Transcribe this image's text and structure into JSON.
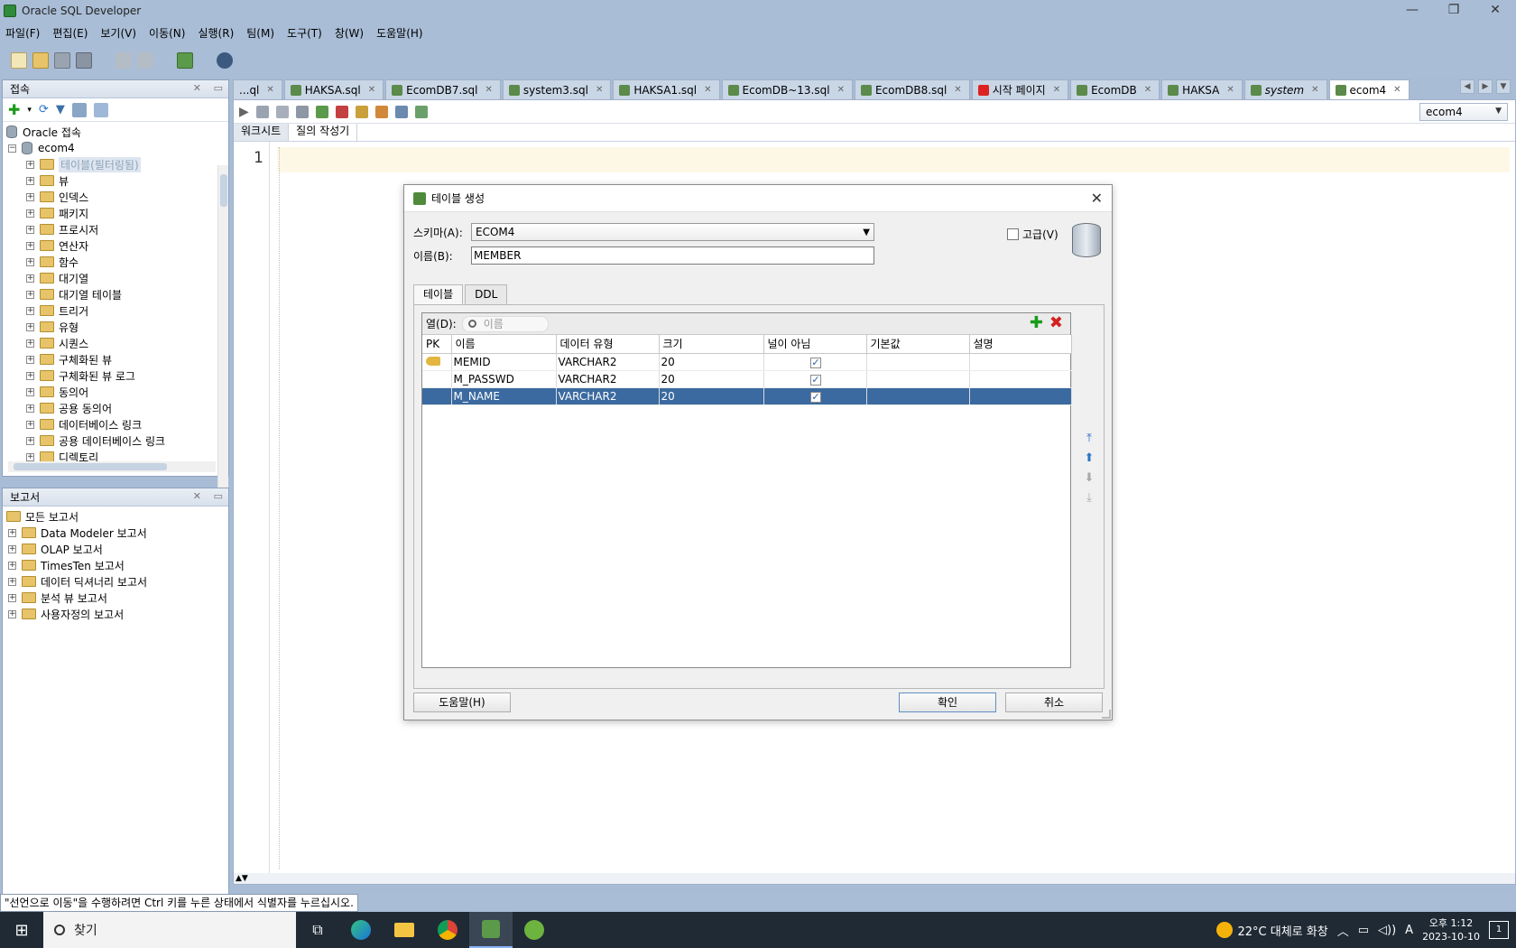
{
  "window": {
    "title": "Oracle SQL Developer",
    "minimize": "—",
    "maximize": "❐",
    "close": "✕"
  },
  "menu": [
    "파일(F)",
    "편집(E)",
    "보기(V)",
    "이동(N)",
    "실행(R)",
    "팀(M)",
    "도구(T)",
    "창(W)",
    "도움말(H)"
  ],
  "connections_panel": {
    "title": "접속",
    "root": "Oracle 접속",
    "connection": "ecom4",
    "items": [
      "테이블(필터링됨)",
      "뷰",
      "인덱스",
      "패키지",
      "프로시저",
      "연산자",
      "함수",
      "대기열",
      "대기열 테이블",
      "트리거",
      "유형",
      "시퀀스",
      "구체화된 뷰",
      "구체화된 뷰 로그",
      "동의어",
      "공용 동의어",
      "데이터베이스 링크",
      "공용 데이터베이스 링크",
      "디렉토리"
    ]
  },
  "reports_panel": {
    "title": "보고서",
    "root": "모든 보고서",
    "items": [
      "Data Modeler 보고서",
      "OLAP 보고서",
      "TimesTen 보고서",
      "데이터 딕셔너리 보고서",
      "분석 뷰 보고서",
      "사용자정의 보고서"
    ]
  },
  "editor_tabs": [
    "...ql",
    "HAKSA.sql",
    "EcomDB7.sql",
    "system3.sql",
    "HAKSA1.sql",
    "EcomDB~13.sql",
    "EcomDB8.sql",
    "시작 페이지",
    "EcomDB",
    "HAKSA",
    "system",
    "ecom4"
  ],
  "editor": {
    "connection": "ecom4",
    "sub_tabs": [
      "워크시트",
      "질의 작성기"
    ],
    "line_number": "1"
  },
  "status": {
    "message": "\"선언으로 이동\"을 수행하려면 Ctrl 키를 누른 상태에서 식별자를 누르십시오."
  },
  "dialog": {
    "title": "테이블 생성",
    "schema_label": "스키마(A):",
    "schema_value": "ECOM4",
    "name_label": "이름(B):",
    "name_value": "MEMBER",
    "advanced_label": "고급(V)",
    "tabs": [
      "테이블",
      "DDL"
    ],
    "columns_label": "열(D):",
    "search_placeholder": "이름",
    "headers": [
      "PK",
      "이름",
      "데이터 유형",
      "크기",
      "널이 아님",
      "기본값",
      "설명"
    ],
    "rows": [
      {
        "pk": true,
        "name": "MEMID",
        "type": "VARCHAR2",
        "size": "20",
        "not_null": true,
        "default": "",
        "desc": ""
      },
      {
        "pk": false,
        "name": "M_PASSWD",
        "type": "VARCHAR2",
        "size": "20",
        "not_null": true,
        "default": "",
        "desc": ""
      },
      {
        "pk": false,
        "name": "M_NAME",
        "type": "VARCHAR2",
        "size": "20",
        "not_null": true,
        "default": "",
        "desc": ""
      }
    ],
    "help_button": "도움말(H)",
    "ok_button": "확인",
    "cancel_button": "취소"
  },
  "taskbar": {
    "search_text": "찾기",
    "weather": "22°C 대체로 화창",
    "time": "오후 1:12",
    "date": "2023-10-10",
    "notifications": "1",
    "ime": "A"
  },
  "colors": {
    "selection": "#3a6a9f",
    "chrome": "#a9bdd6"
  }
}
